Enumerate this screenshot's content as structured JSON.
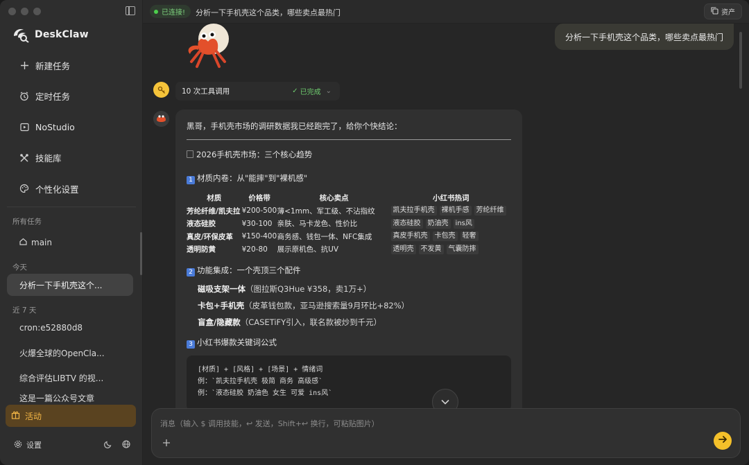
{
  "app": {
    "name": "DeskClaw"
  },
  "sidebar": {
    "nav": [
      {
        "label": "新建任务",
        "icon": "plus-icon"
      },
      {
        "label": "定时任务",
        "icon": "alarm-icon"
      },
      {
        "label": "NoStudio",
        "icon": "play-icon"
      },
      {
        "label": "技能库",
        "icon": "tools-icon"
      },
      {
        "label": "个性化设置",
        "icon": "palette-icon"
      }
    ],
    "all_tasks_label": "所有任务",
    "main_label": "main",
    "today_label": "今天",
    "today_tasks": [
      "分析一下手机壳这个..."
    ],
    "week_label": "近 7 天",
    "week_tasks": [
      "cron:e52880d8",
      "火爆全球的OpenCla...",
      "综合评估LIBTV 的视...",
      "这是一篇公众号文章"
    ],
    "activity_label": "活动",
    "settings_label": "设置"
  },
  "topbar": {
    "status": "已连接!",
    "title": "分析一下手机壳这个品类，哪些卖点最热门",
    "assets": "资产"
  },
  "chat": {
    "user_message": "分析一下手机壳这个品类，哪些卖点最热门",
    "tool": {
      "label": "10 次工具调用",
      "status": "已完成"
    },
    "reply": {
      "intro": "黑哥，手机壳市场的调研数据我已经跑完了，给你个快结论：",
      "heading": "2026手机壳市场：三个核心趋势",
      "sec1_num": "1",
      "sec1_title": "材质内卷：从\"能摔\"到\"裸机感\"",
      "table_headers": [
        "材质",
        "价格带",
        "核心卖点",
        "小红书热词"
      ],
      "table_rows": [
        {
          "material": "芳纶纤维/凯夫拉",
          "price": "¥200-500",
          "points": "薄<1mm、军工级、不沾指纹",
          "tags": [
            "凯夫拉手机壳",
            "裸机手感",
            "芳纶纤维"
          ]
        },
        {
          "material": "液态硅胶",
          "price": "¥30-100",
          "points": "亲肤、马卡龙色、性价比",
          "tags": [
            "液态硅胶",
            "奶油壳",
            "ins风"
          ]
        },
        {
          "material": "真皮/环保皮革",
          "price": "¥150-400",
          "points": "商务感、钱包一体、NFC集成",
          "tags": [
            "真皮手机壳",
            "卡包壳",
            "轻奢"
          ]
        },
        {
          "material": "透明防黄",
          "price": "¥20-80",
          "points": "展示原机色、抗UV",
          "tags": [
            "透明壳",
            "不发黄",
            "气囊防摔"
          ]
        }
      ],
      "sec2_num": "2",
      "sec2_title": "功能集成：一个壳顶三个配件",
      "features": [
        {
          "name": "磁吸支架一体",
          "detail": "（图拉斯Q3Hue ¥358，卖1万+）"
        },
        {
          "name": "卡包+手机壳",
          "detail": "（皮革钱包款，亚马逊搜索量9月环比+82%）"
        },
        {
          "name": "盲盒/隐藏款",
          "detail": "（CASETiFY引入，联名款被炒到千元）"
        }
      ],
      "sec3_num": "3",
      "sec3_title": "小红书爆款关键词公式",
      "code_lines": [
        "[材质] + [风格] + [场景] + 情绪词",
        "例：`凯夫拉手机壳 极简 商务 高级感`",
        "例：`液态硅胶 奶油色 女生 可爱 ins风`"
      ]
    }
  },
  "input": {
    "placeholder": "消息（输入 $ 调用技能，↩ 发送，Shift+↩ 换行，可粘贴图片）"
  },
  "colors": {
    "accent": "#f4c02a",
    "connected": "#4ccf4c",
    "activity": "#f3b646"
  }
}
